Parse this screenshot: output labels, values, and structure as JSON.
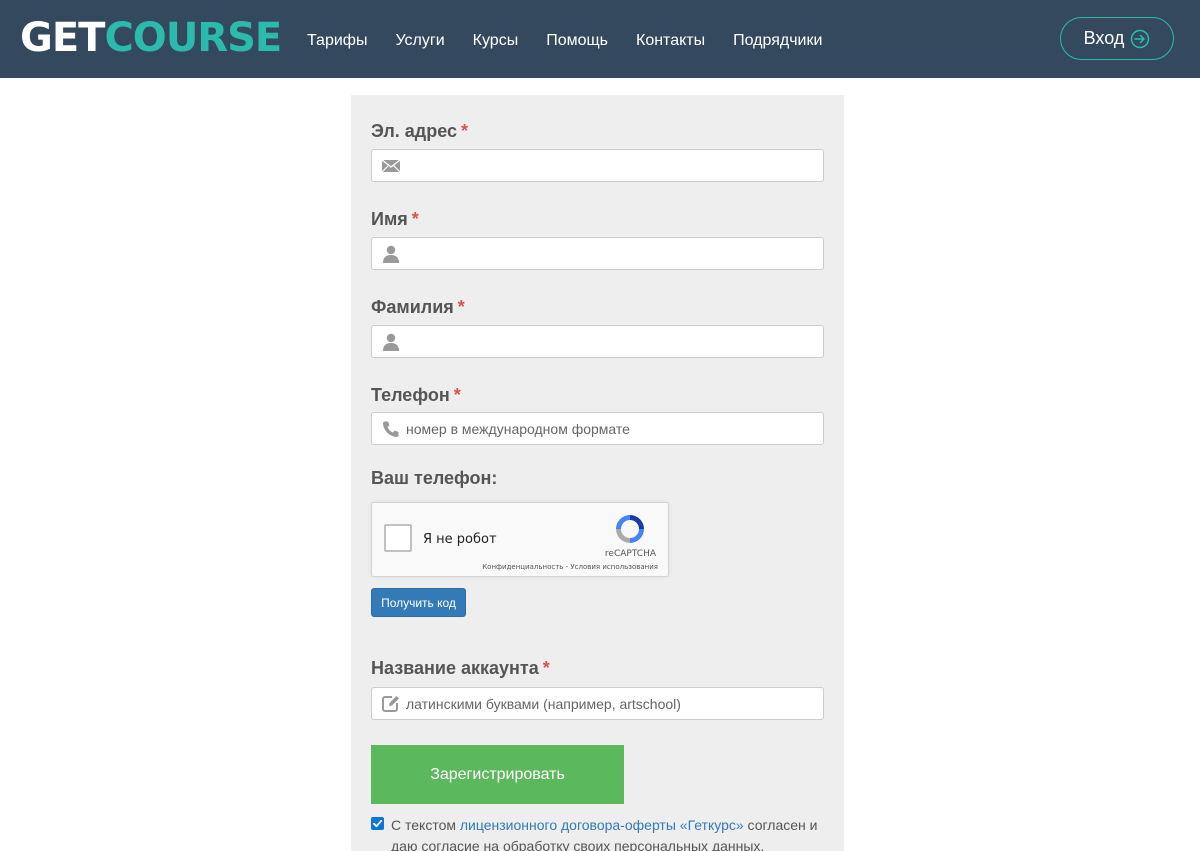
{
  "header": {
    "logo_left": "GET",
    "logo_right": "COURSE",
    "nav": [
      "Тарифы",
      "Услуги",
      "Курсы",
      "Помощь",
      "Контакты",
      "Подрядчики"
    ],
    "login_label": "Вход"
  },
  "form": {
    "email": {
      "label": "Эл. адрес",
      "required": "*",
      "value": "",
      "placeholder": "",
      "icon": "envelope-icon"
    },
    "first_name": {
      "label": "Имя",
      "required": "*",
      "value": "",
      "placeholder": "",
      "icon": "person-icon"
    },
    "last_name": {
      "label": "Фамилия",
      "required": "*",
      "value": "",
      "placeholder": "",
      "icon": "person-icon"
    },
    "phone": {
      "label": "Телефон",
      "required": "*",
      "value": "",
      "placeholder": "номер в международном формате",
      "icon": "phone-icon"
    },
    "your_phone_label": "Ваш телефон:",
    "recaptcha": {
      "text": "Я не робот",
      "brand": "reCAPTCHA",
      "privacy": "Конфиденциальность",
      "separator": " - ",
      "terms": "Условия использования"
    },
    "get_code_label": "Получить код",
    "account": {
      "label": "Название аккаунта",
      "required": "*",
      "value": "",
      "placeholder": "латинскими буквами (например, artschool)",
      "icon": "edit-icon"
    },
    "register_label": "Зарегистрировать",
    "consent": {
      "checked": true,
      "before": "С текстом ",
      "link": "лицензионного договора-оферты «Геткурс»",
      "after": " согласен и даю согласие на обработку своих персональных данных."
    }
  },
  "colors": {
    "header_bg": "#34495e",
    "accent": "#2bbbad",
    "primary_button": "#337ab7",
    "success_button": "#5cb85c",
    "required": "#d9534f"
  }
}
